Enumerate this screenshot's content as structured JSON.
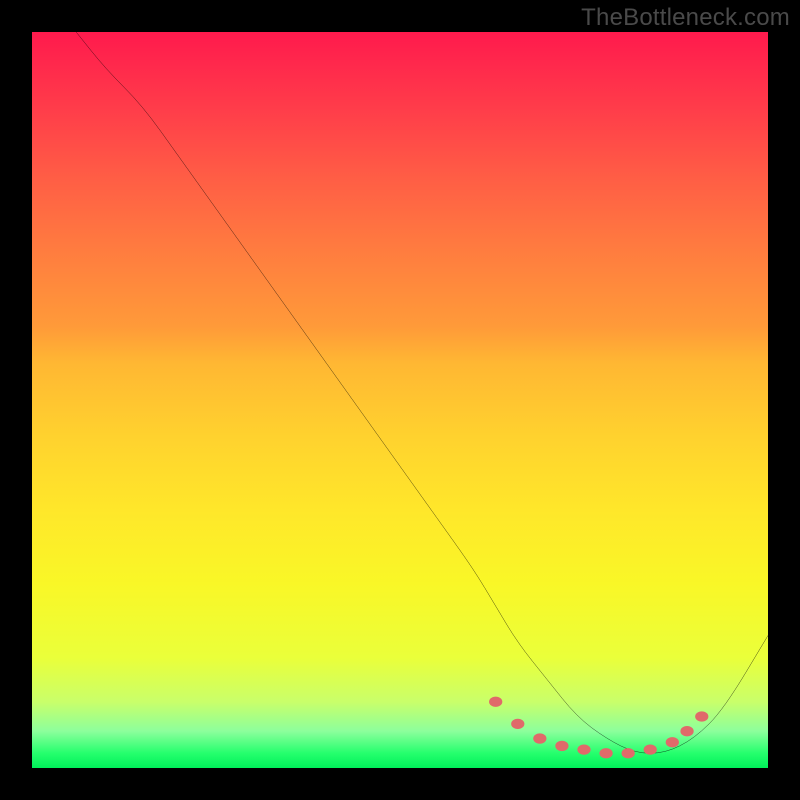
{
  "watermark": "TheBottleneck.com",
  "chart_data": {
    "type": "line",
    "title": "",
    "xlabel": "",
    "ylabel": "",
    "xlim": [
      0,
      100
    ],
    "ylim": [
      0,
      100
    ],
    "grid": false,
    "series": [
      {
        "name": "curve",
        "stroke": "#000000",
        "x": [
          6,
          10,
          15,
          20,
          25,
          30,
          35,
          40,
          45,
          50,
          55,
          60,
          63,
          66,
          70,
          74,
          78,
          82,
          86,
          90,
          94,
          100
        ],
        "values": [
          100,
          95,
          90,
          83,
          76,
          69,
          62,
          55,
          48,
          41,
          34,
          27,
          22,
          17,
          12,
          7,
          4,
          2,
          2,
          4,
          8,
          18
        ]
      }
    ],
    "markers": {
      "name": "highlight-dots",
      "color": "#e06a6a",
      "points": [
        {
          "x": 63,
          "y": 9
        },
        {
          "x": 66,
          "y": 6
        },
        {
          "x": 69,
          "y": 4
        },
        {
          "x": 72,
          "y": 3
        },
        {
          "x": 75,
          "y": 2.5
        },
        {
          "x": 78,
          "y": 2
        },
        {
          "x": 81,
          "y": 2
        },
        {
          "x": 84,
          "y": 2.5
        },
        {
          "x": 87,
          "y": 3.5
        },
        {
          "x": 89,
          "y": 5
        },
        {
          "x": 91,
          "y": 7
        }
      ]
    }
  }
}
